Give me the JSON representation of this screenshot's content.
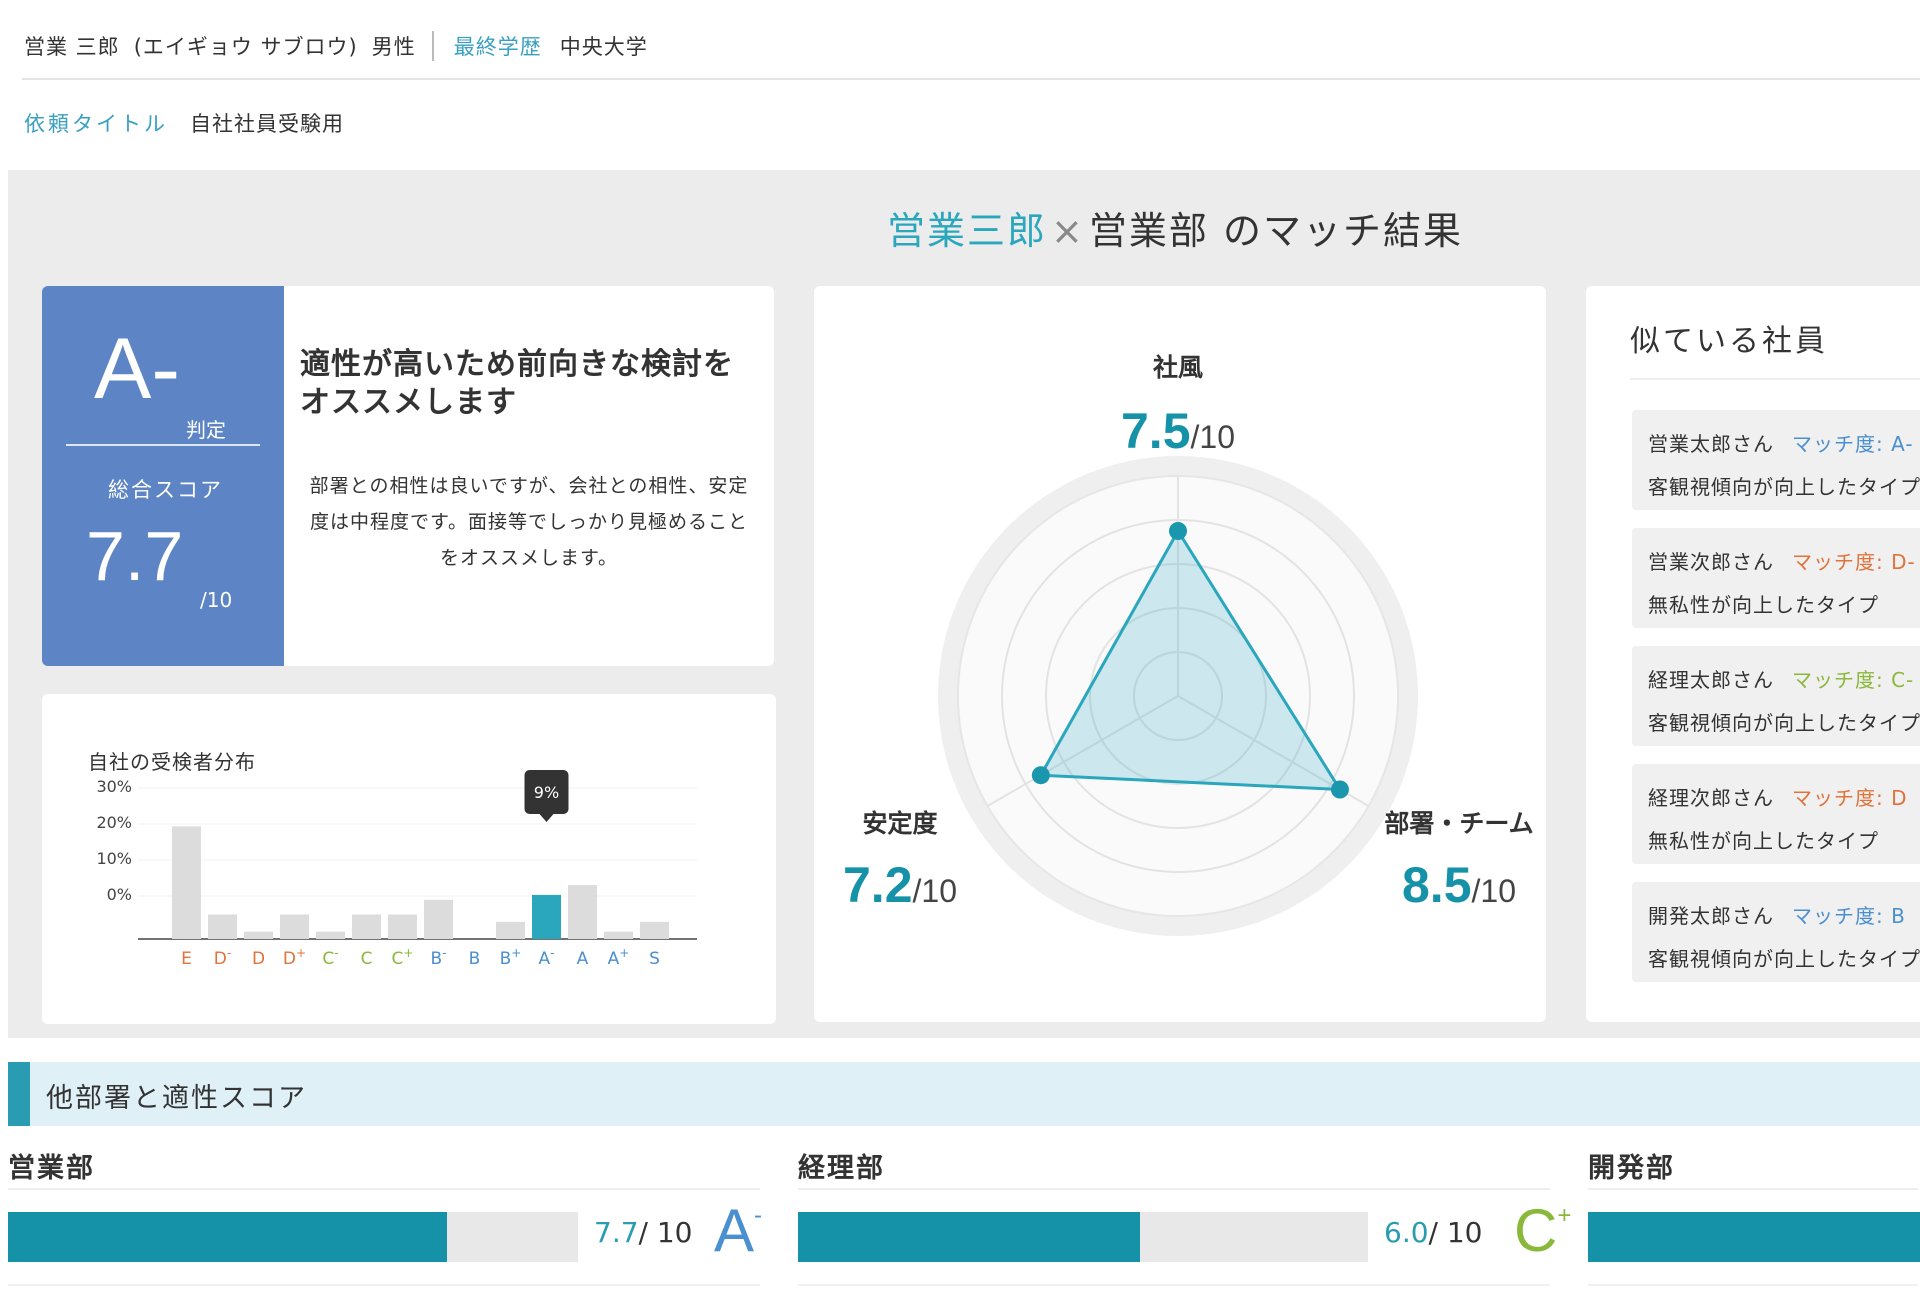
{
  "header": {
    "name": "営業 三郎",
    "kana": "(エイギョウ サブロウ)",
    "gender": "男性",
    "edu_label": "最終学歴",
    "edu_value": "中央大学"
  },
  "request": {
    "label": "依頼タイトル",
    "value": "自社社員受験用"
  },
  "match": {
    "person": "営業三郎",
    "cross": "×",
    "dept": "営業部 のマッチ結果"
  },
  "score": {
    "grade": "A-",
    "hantei": "判定",
    "total_label": "総合スコア",
    "total_value": "7.7",
    "total_den": "/10",
    "headline": "適性が高いため前向きな検討をオススメします",
    "description": "部署との相性は良いですが、会社との相性、安定度は中程度です。面接等でしっかり見極めることをオススメします。",
    "color": "#5d85c5"
  },
  "chart_data": [
    {
      "type": "bar",
      "title": "自社の受検者分布",
      "categories": [
        "E",
        "D-",
        "D",
        "D+",
        "C-",
        "C",
        "C+",
        "B-",
        "B",
        "B+",
        "A-",
        "A",
        "A+",
        "S"
      ],
      "category_labels": [
        {
          "base": "E",
          "sup": ""
        },
        {
          "base": "D",
          "sup": "-"
        },
        {
          "base": "D",
          "sup": ""
        },
        {
          "base": "D",
          "sup": "+"
        },
        {
          "base": "C",
          "sup": "-"
        },
        {
          "base": "C",
          "sup": ""
        },
        {
          "base": "C",
          "sup": "+"
        },
        {
          "base": "B",
          "sup": "-"
        },
        {
          "base": "B",
          "sup": ""
        },
        {
          "base": "B",
          "sup": "+"
        },
        {
          "base": "A",
          "sup": "-"
        },
        {
          "base": "A",
          "sup": ""
        },
        {
          "base": "A",
          "sup": "+"
        },
        {
          "base": "S",
          "sup": ""
        }
      ],
      "category_colors": [
        "#e0733a",
        "#e0733a",
        "#e0733a",
        "#e0733a",
        "#8ab83a",
        "#8ab83a",
        "#8ab83a",
        "#4a8fcf",
        "#4a8fcf",
        "#4a8fcf",
        "#4a8fcf",
        "#4a8fcf",
        "#4a8fcf",
        "#4a8fcf"
      ],
      "values": [
        23,
        5,
        1.5,
        5,
        1.5,
        5,
        5,
        8,
        0,
        3.5,
        9,
        11,
        1.5,
        3.5
      ],
      "yticks": [
        "30%",
        "20%",
        "10%",
        "0%"
      ],
      "ylim": [
        0,
        30
      ],
      "highlight_index": 10,
      "highlight_label": "9%",
      "bar_color": "#dcdcdc",
      "highlight_color": "#2aa6bd"
    },
    {
      "type": "radar",
      "axes": [
        {
          "label": "社風",
          "value": 7.5,
          "display": "7.5",
          "den": "/10"
        },
        {
          "label": "部署・チーム",
          "value": 8.5,
          "display": "8.5",
          "den": "/10"
        },
        {
          "label": "安定度",
          "value": 7.2,
          "display": "7.2",
          "den": "/10"
        }
      ],
      "max": 10,
      "fill_color": "#2aa6bd"
    }
  ],
  "similar": {
    "title": "似ている社員",
    "items": [
      {
        "name": "営業太郎さん",
        "match": "マッチ度: A-",
        "match_color": "#4a8fcf",
        "desc": "客観視傾向が向上したタイプ"
      },
      {
        "name": "営業次郎さん",
        "match": "マッチ度: D-",
        "match_color": "#e0733a",
        "desc": "無私性が向上したタイプ"
      },
      {
        "name": "経理太郎さん",
        "match": "マッチ度: C-",
        "match_color": "#8ab83a",
        "desc": "客観視傾向が向上したタイプ"
      },
      {
        "name": "経理次郎さん",
        "match": "マッチ度: D",
        "match_color": "#e0733a",
        "desc": "無私性が向上したタイプ"
      },
      {
        "name": "開発太郎さん",
        "match": "マッチ度: B",
        "match_color": "#4a8fcf",
        "desc": "客観視傾向が向上したタイプ"
      }
    ]
  },
  "other": {
    "title": "他部署と適性スコア",
    "depts": [
      {
        "name": "営業部",
        "value": "7.7",
        "den": "/ 10",
        "grade": "A",
        "grade_sup": "-",
        "grade_color": "#4a8fcf",
        "fraction": 0.77
      },
      {
        "name": "経理部",
        "value": "6.0",
        "den": "/ 10",
        "grade": "C",
        "grade_sup": "+",
        "grade_color": "#8ab83a",
        "fraction": 0.6
      },
      {
        "name": "開発部",
        "value": "",
        "den": "",
        "grade": "",
        "grade_sup": "",
        "grade_color": "#4a8fcf",
        "fraction": 1.0
      }
    ]
  }
}
